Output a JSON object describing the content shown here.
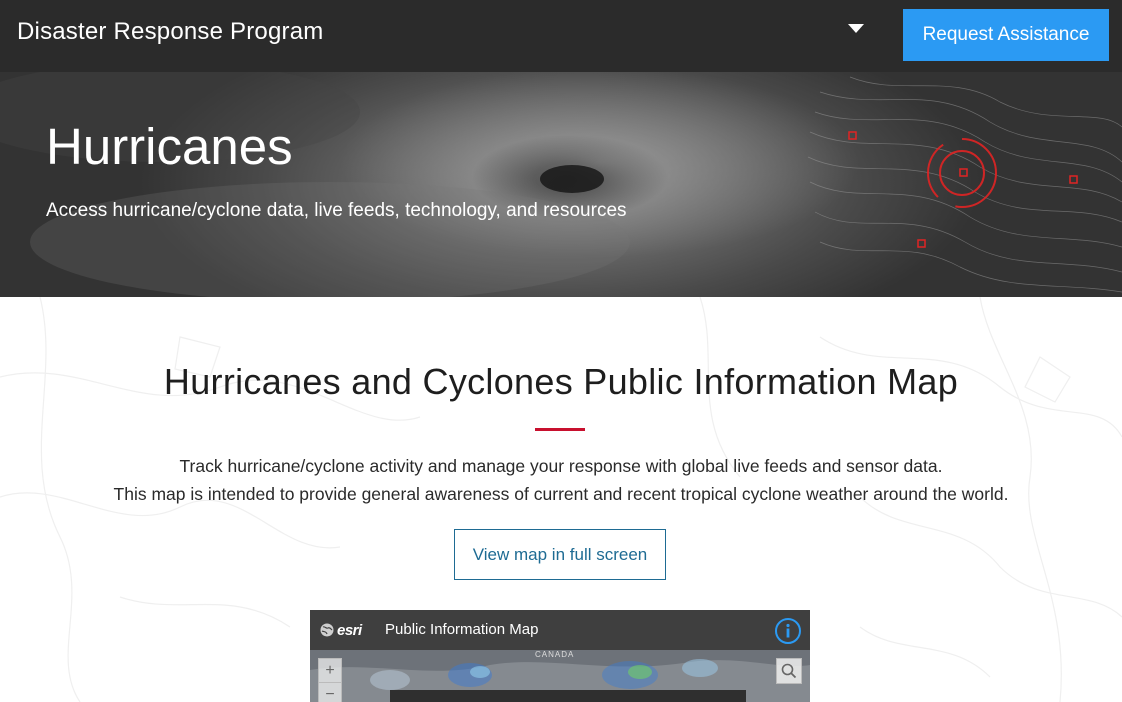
{
  "header": {
    "site_title": "Disaster Response Program",
    "request_button_label": "Request Assistance",
    "accent_color": "#2b9af3"
  },
  "hero": {
    "title": "Hurricanes",
    "subtitle": "Access hurricane/cyclone data, live feeds, technology, and resources"
  },
  "main": {
    "section_title": "Hurricanes and Cyclones Public Information Map",
    "description_line1": "Track hurricane/cyclone activity and manage your response with global live feeds and sensor data.",
    "description_line2": "This map is intended to provide general awareness of current and recent tropical cyclone weather around the world.",
    "fullscreen_button_label": "View map in full screen",
    "divider_color": "#c8102e"
  },
  "map_embed": {
    "logo_text": "esri",
    "title": "Public Information Map",
    "map_label": "CANADA",
    "icons": [
      "globe-icon",
      "info-icon",
      "zoom-in-icon",
      "zoom-out-icon",
      "search-icon"
    ]
  }
}
